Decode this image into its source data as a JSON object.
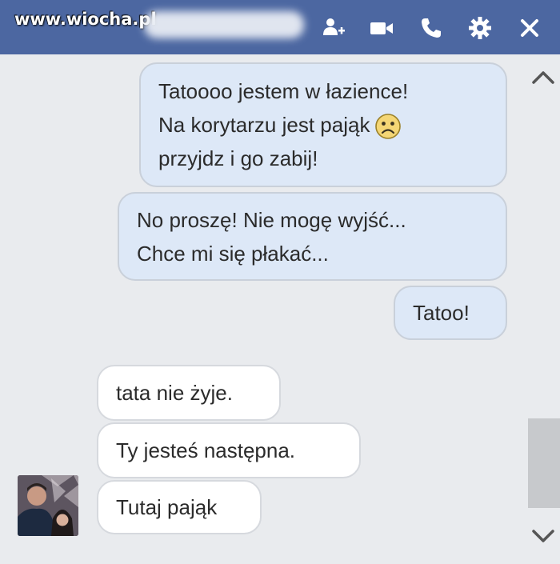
{
  "watermark": "www.wiocha.pl",
  "header": {
    "icons": [
      "add-person-icon",
      "video-icon",
      "phone-icon",
      "gear-icon",
      "close-icon"
    ]
  },
  "messages": [
    {
      "direction": "outgoing",
      "lines": [
        "Tatoooo jestem w łazience!",
        "Na korytarzu jest pająk",
        "przyjdz i go zabij!"
      ],
      "emoji": "sad-face-icon"
    },
    {
      "direction": "outgoing",
      "lines": [
        "No proszę! Nie mogę wyjść...",
        "Chce mi się płakać..."
      ]
    },
    {
      "direction": "outgoing",
      "lines": [
        "Tatoo!"
      ]
    },
    {
      "direction": "incoming",
      "lines": [
        "tata nie żyje."
      ]
    },
    {
      "direction": "incoming",
      "lines": [
        "Ty jesteś następna."
      ]
    },
    {
      "direction": "incoming",
      "lines": [
        "Tutaj pająk"
      ]
    }
  ],
  "colors": {
    "titlebar": "#4c67a1",
    "outgoing_bubble": "#dde8f7",
    "incoming_bubble": "#ffffff",
    "background": "#e9ebee"
  }
}
